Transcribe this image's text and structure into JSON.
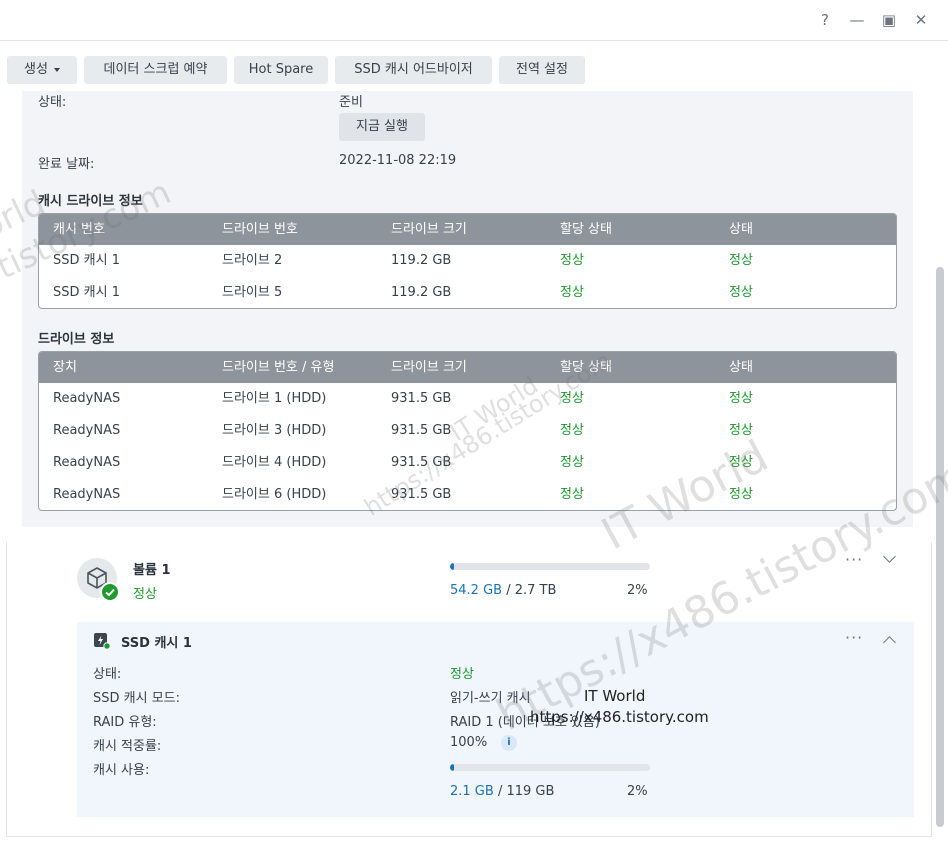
{
  "window": {
    "help": "?",
    "minimize": "—",
    "maximize": "▣",
    "close": "✕"
  },
  "toolbar": {
    "create": "생성",
    "scrub_schedule": "데이터 스크럽 예약",
    "hot_spare": "Hot Spare",
    "ssd_advisor": "SSD 캐시 어드바이저",
    "global_settings": "전역 설정"
  },
  "detail": {
    "status_label": "상태:",
    "status_value": "준비",
    "run_now": "지금 실행",
    "completed_label": "완료 날짜:",
    "completed_value": "2022-11-08 22:19",
    "cache_drive_title": "캐시 드라이브 정보",
    "cache_columns": [
      "캐시 번호",
      "드라이브 번호",
      "드라이브 크기",
      "할당 상태",
      "상태"
    ],
    "cache_rows": [
      [
        "SSD 캐시 1",
        "드라이브 2",
        "119.2 GB",
        "정상",
        "정상"
      ],
      [
        "SSD 캐시 1",
        "드라이브 5",
        "119.2 GB",
        "정상",
        "정상"
      ]
    ],
    "drive_title": "드라이브 정보",
    "drive_columns": [
      "장치",
      "드라이브 번호 / 유형",
      "드라이브 크기",
      "할당 상태",
      "상태"
    ],
    "drive_rows": [
      [
        "ReadyNAS",
        "드라이브 1 (HDD)",
        "931.5 GB",
        "정상",
        "정상"
      ],
      [
        "ReadyNAS",
        "드라이브 3 (HDD)",
        "931.5 GB",
        "정상",
        "정상"
      ],
      [
        "ReadyNAS",
        "드라이브 4 (HDD)",
        "931.5 GB",
        "정상",
        "정상"
      ],
      [
        "ReadyNAS",
        "드라이브 6 (HDD)",
        "931.5 GB",
        "정상",
        "정상"
      ]
    ]
  },
  "volume": {
    "name": "볼륨 1",
    "status": "정상",
    "used": "54.2 GB",
    "sep": " / ",
    "total": "2.7 TB",
    "percent": "2%",
    "usage_fraction": 0.02,
    "more": "···"
  },
  "ssd_cache": {
    "name": "SSD 캐시 1",
    "more": "···",
    "fields": [
      {
        "label": "상태:",
        "value": "정상"
      },
      {
        "label": "SSD 캐시 모드:",
        "value": "읽기-쓰기 캐시"
      },
      {
        "label": "RAID 유형:",
        "value": "RAID 1 (데이터 보호 있음)"
      },
      {
        "label": "캐시 적중률:",
        "value": "100%"
      },
      {
        "label": "캐시 사용:",
        "value": ""
      }
    ],
    "info_icon": "i",
    "used": "2.1 GB",
    "sep": " / ",
    "total": "119 GB",
    "percent": "2%",
    "usage_fraction": 0.02
  },
  "watermark": {
    "brand": "IT World",
    "url": "https://x486.tistory.com",
    "fragment_a": "orld",
    "fragment_b": "tistory.com"
  },
  "colors": {
    "ok": "#1f9a2f",
    "accent": "#1a73b8",
    "header": "#8e949b"
  }
}
